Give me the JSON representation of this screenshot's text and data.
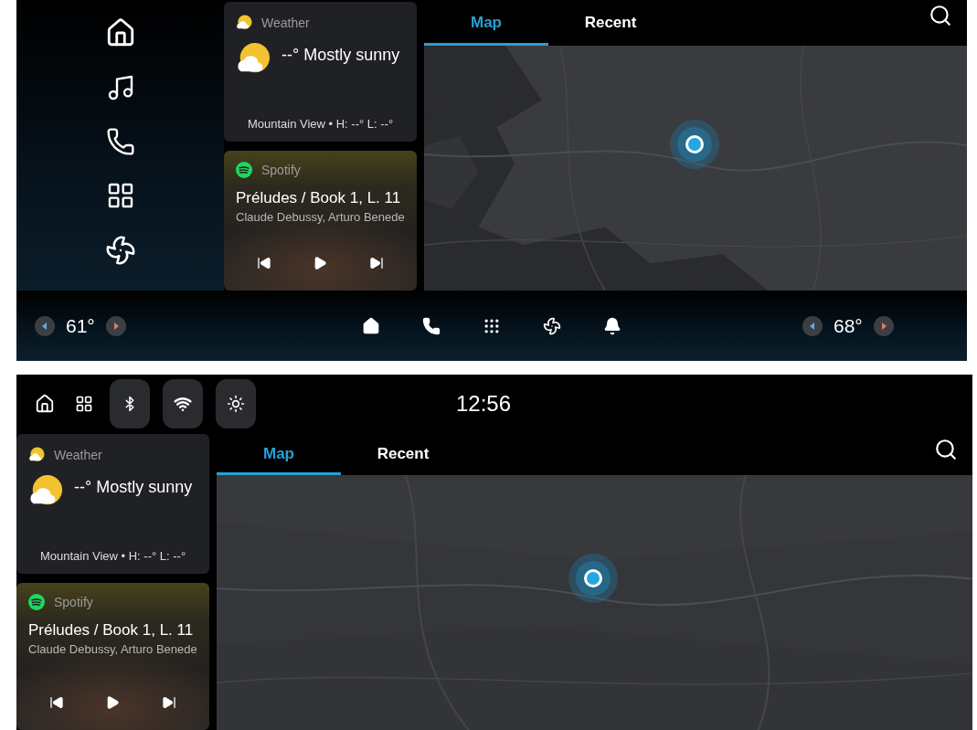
{
  "dashboard": {
    "weather": {
      "app": "Weather",
      "condition": "--° Mostly sunny",
      "details": "Mountain View • H: --° L: --°"
    },
    "media": {
      "app": "Spotify",
      "title": "Préludes / Book 1, L. 11",
      "artist": "Claude Debussy, Arturo Benede"
    },
    "tabs": [
      {
        "label": "Map",
        "selected": true
      },
      {
        "label": "Recent",
        "selected": false
      }
    ],
    "climate": {
      "driver_temp": "61°",
      "passenger_temp": "68°"
    }
  },
  "compact": {
    "status_bar": {
      "time": "12:56"
    },
    "weather": {
      "app": "Weather",
      "condition": "--° Mostly sunny",
      "details": "Mountain View • H: --° L: --°"
    },
    "media": {
      "app": "Spotify",
      "title": "Préludes / Book 1, L. 11",
      "artist": "Claude Debussy, Arturo Benede"
    },
    "tabs": [
      {
        "label": "Map",
        "selected": true
      },
      {
        "label": "Recent",
        "selected": false
      }
    ]
  }
}
